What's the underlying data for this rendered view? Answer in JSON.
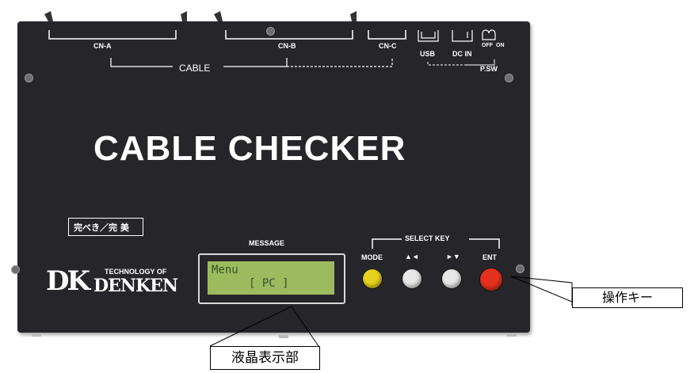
{
  "device": {
    "top_labels": {
      "cn_a": "CN-A",
      "cn_b": "CN-B",
      "cn_c": "CN-C",
      "cable": "CABLE",
      "usb": "USB",
      "dc_in": "DC IN",
      "p_sw": "P.SW",
      "on": "ON",
      "off": "OFF"
    },
    "main_title": "CABLE CHECKER",
    "sticker": "完べき／完 美",
    "message_label": "MESSAGE",
    "select_key_label": "SELECT KEY",
    "keys": {
      "mode": "MODE",
      "left_up": "▲◄",
      "right_down": "►▼",
      "ent": "ENT"
    },
    "logo": {
      "mark": "DK",
      "tagline": "TECHNOLOGY OF",
      "name": "DENKEN"
    },
    "lcd": {
      "line1": "Menu",
      "line2": "[ PC ]"
    }
  },
  "colors": {
    "mode_button": "#e6d21e",
    "up_button": "#e8e8e8",
    "down_button": "#e8e8e8",
    "ent_button": "#e5321e",
    "lcd_bg": "#9dbb5e"
  },
  "callouts": {
    "operation_keys": "操作キー",
    "lcd_display": "液晶表示部"
  }
}
